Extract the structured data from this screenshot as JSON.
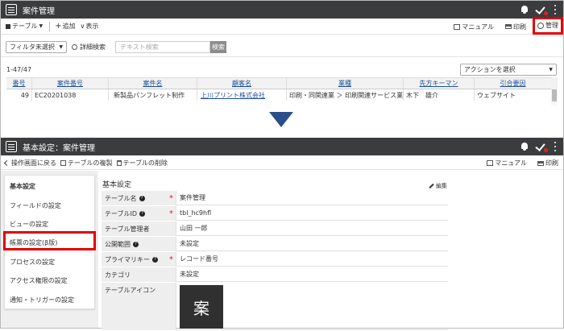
{
  "top": {
    "app_title": "案件管理",
    "view_select": "テーブル",
    "add_label": "追加",
    "view_label": "表示",
    "manual_label": "マニュアル",
    "print_label": "印刷",
    "manage_label": "管理",
    "filter_select": "フィルタ未選択",
    "advanced_search": "詳細検索",
    "search_placeholder": "テキスト検索",
    "search_button": "検索",
    "record_count": "1-47/47",
    "action_select": "アクションを選択",
    "table": {
      "headers": [
        "番号",
        "案件番号",
        "案件名",
        "顧客名",
        "業種",
        "先方キーマン",
        "引合要因"
      ],
      "rows": [
        [
          "49",
          "EC20201038",
          "新製品パンフレット制作",
          "上川プリント株式会社",
          "印刷・同関連業 ＞ 印刷関連サービス業",
          "木下　雄介",
          "ウェブサイト"
        ]
      ]
    }
  },
  "bottom": {
    "app_title": "基本設定：案件管理",
    "back_label": "操作画面に戻る",
    "copy_label": "テーブルの複製",
    "delete_label": "テーブルの削除",
    "manual_label": "マニュアル",
    "print_label": "印刷",
    "sidebar": {
      "items": [
        {
          "label": "基本設定"
        },
        {
          "label": "フィールドの設定"
        },
        {
          "label": "ビューの設定"
        },
        {
          "label": "帳票の設定(β版)"
        },
        {
          "label": "プロセスの設定"
        },
        {
          "label": "アクセス権限の設定"
        },
        {
          "label": "通知・トリガーの設定"
        }
      ]
    },
    "section_title": "基本設定",
    "edit_label": "編集",
    "fields": [
      {
        "label": "テーブル名",
        "value": "案件管理"
      },
      {
        "label": "テーブルID",
        "value": "tbl_hc9hfl"
      },
      {
        "label": "テーブル管理者",
        "value": "山田 一郎"
      },
      {
        "label": "公開範囲",
        "value": "未設定"
      },
      {
        "label": "プライマリキー",
        "value": "レコード番号"
      },
      {
        "label": "カテゴリ",
        "value": "未設定"
      },
      {
        "label": "テーブルアイコン",
        "value": "案"
      }
    ]
  },
  "colors": {
    "topbar": "#3b3c3e",
    "highlight": "#e40000",
    "link": "#1c4f9c",
    "arrow": "#2b4f8a",
    "required": "#dd2222"
  }
}
